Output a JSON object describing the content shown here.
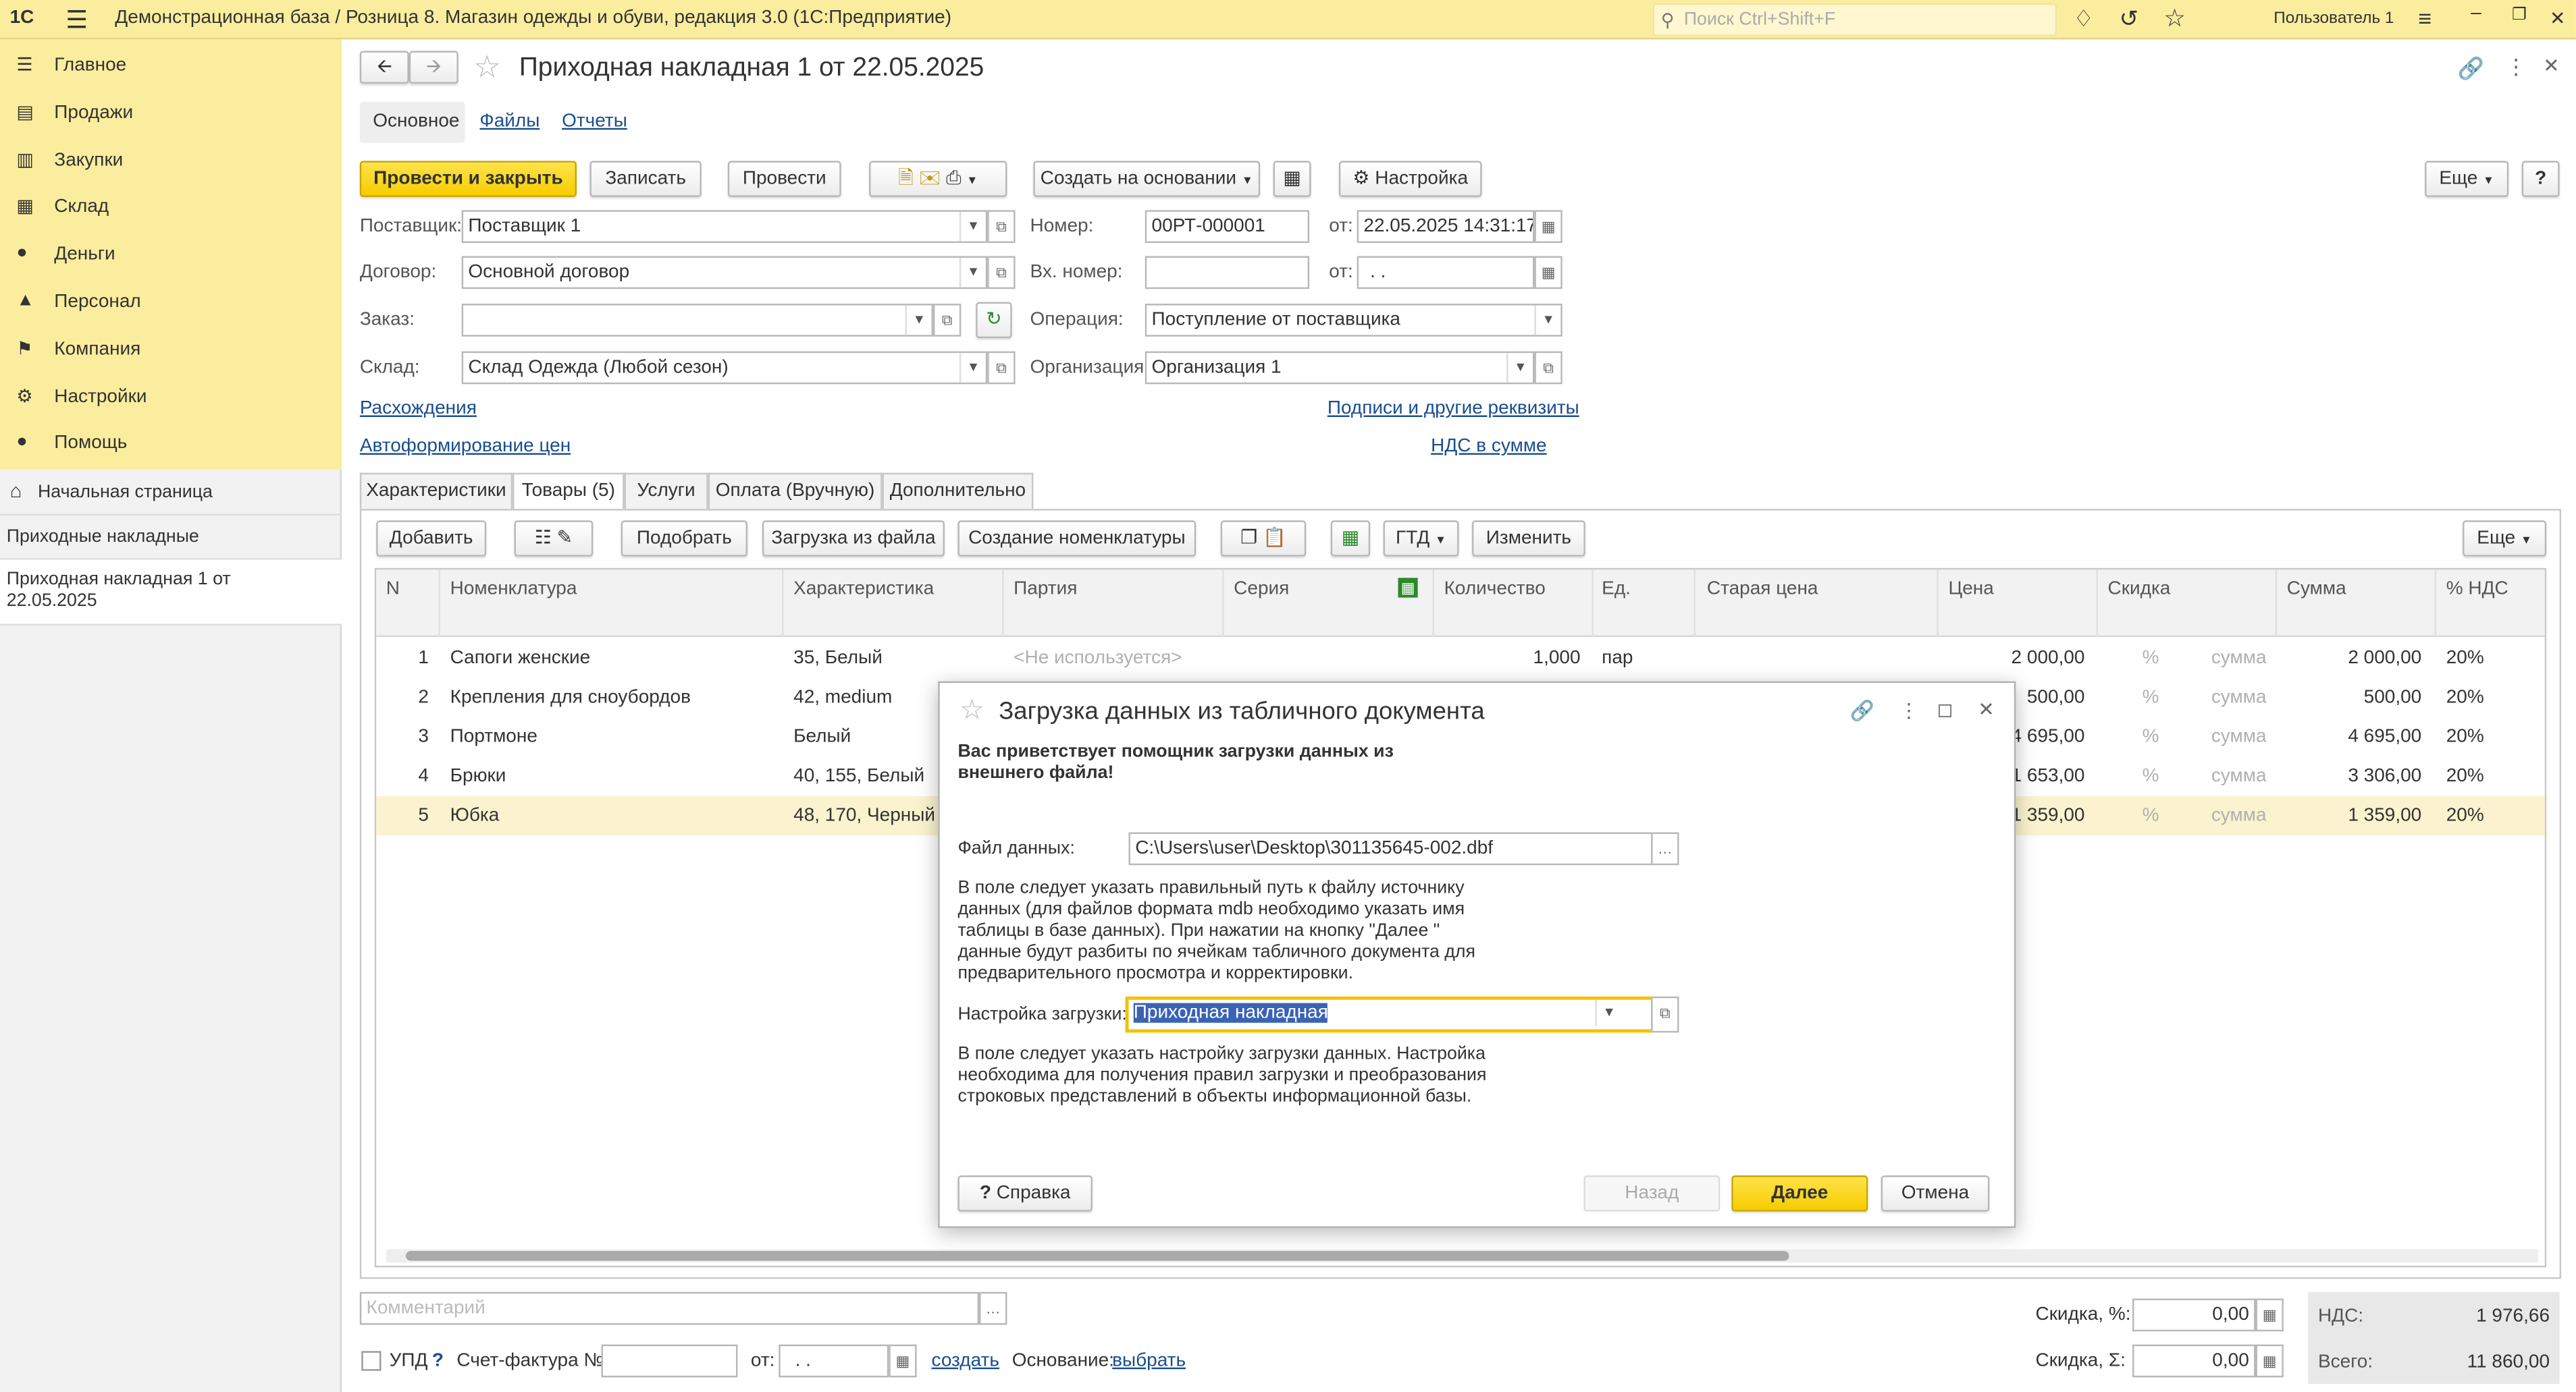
{
  "window": {
    "title": "Демонстрационная база / Розница 8. Магазин одежды и обуви, редакция 3.0  (1С:Предприятие)",
    "search_placeholder": "Поиск Ctrl+Shift+F",
    "user": "Пользователь 1",
    "logo": "1С"
  },
  "sidebar": {
    "items": [
      {
        "label": "Главное",
        "icon": "menu-icon"
      },
      {
        "label": "Продажи",
        "icon": "cart-icon"
      },
      {
        "label": "Закупки",
        "icon": "purchase-icon"
      },
      {
        "label": "Склад",
        "icon": "warehouse-icon"
      },
      {
        "label": "Деньги",
        "icon": "money-icon"
      },
      {
        "label": "Персонал",
        "icon": "people-icon"
      },
      {
        "label": "Компания",
        "icon": "flag-icon"
      },
      {
        "label": "Настройки",
        "icon": "gear-icon"
      },
      {
        "label": "Помощь",
        "icon": "help-icon"
      }
    ],
    "open": [
      {
        "label": "Начальная страница"
      },
      {
        "label": "Приходные накладные"
      },
      {
        "label": "Приходная накладная 1 от 22.05.2025"
      }
    ]
  },
  "doc": {
    "title": "Приходная накладная 1 от 22.05.2025",
    "subtabs": [
      "Основное",
      "Файлы",
      "Отчеты"
    ],
    "toolbar": {
      "post_close": "Провести и закрыть",
      "save": "Записать",
      "post": "Провести",
      "create_based": "Создать на основании",
      "settings": "Настройка",
      "more": "Еще",
      "help": "?"
    },
    "fields": {
      "supplier_label": "Поставщик:",
      "supplier": "Поставщик 1",
      "contract_label": "Договор:",
      "contract": "Основной договор",
      "order_label": "Заказ:",
      "order": "",
      "warehouse_label": "Склад:",
      "warehouse": "Склад Одежда (Любой сезон)",
      "number_label": "Номер:",
      "number": "00РТ-000001",
      "from_label": "от:",
      "date": "22.05.2025 14:31:17",
      "in_number_label": "Вх. номер:",
      "in_number": "",
      "from2_label": "от:",
      "in_date": " .  .",
      "operation_label": "Операция:",
      "operation": "Поступление от поставщика",
      "org_label": "Организация:",
      "org": "Организация 1"
    },
    "links": {
      "discrepancies": "Расхождения",
      "autoprice": "Автоформирование цен",
      "signatures": "Подписи и другие реквизиты",
      "vat_incl": "НДС в сумме"
    },
    "tabs": [
      "Характеристики",
      "Товары (5)",
      "Услуги",
      "Оплата (Вручную)",
      "Дополнительно"
    ],
    "table_toolbar": {
      "add": "Добавить",
      "pick": "Подобрать",
      "load_file": "Загрузка из файла",
      "create_nom": "Создание номенклатуры",
      "gtd": "ГТД",
      "change": "Изменить",
      "more": "Еще"
    },
    "columns": [
      "N",
      "Номенклатура",
      "Характеристика",
      "Партия",
      "Серия",
      "Количество",
      "Ед.",
      "Старая цена",
      "Цена",
      "Скидка",
      "Сумма",
      "% НДС"
    ],
    "rows": [
      {
        "n": "1",
        "name": "Сапоги женские",
        "char": "35, Белый",
        "batch": "<Не используется>",
        "qty": "1,000",
        "unit": "пар",
        "price": "2 000,00",
        "disc": "%",
        "disc_sum": "сумма",
        "sum": "2 000,00",
        "vat": "20%"
      },
      {
        "n": "2",
        "name": "Крепления для сноубордов",
        "char": "42, medium",
        "batch": "",
        "qty": "",
        "unit": "",
        "price": "500,00",
        "disc": "%",
        "disc_sum": "сумма",
        "sum": "500,00",
        "vat": "20%"
      },
      {
        "n": "3",
        "name": "Портмоне",
        "char": "Белый",
        "batch": "",
        "qty": "",
        "unit": "",
        "price": "4 695,00",
        "disc": "%",
        "disc_sum": "сумма",
        "sum": "4 695,00",
        "vat": "20%"
      },
      {
        "n": "4",
        "name": "Брюки",
        "char": "40, 155, Белый",
        "batch": "",
        "qty": "",
        "unit": "",
        "price": "1 653,00",
        "disc": "%",
        "disc_sum": "сумма",
        "sum": "3 306,00",
        "vat": "20%"
      },
      {
        "n": "5",
        "name": "Юбка",
        "char": "48, 170, Черный",
        "batch": "",
        "qty": "",
        "unit": "",
        "price": "1 359,00",
        "disc": "%",
        "disc_sum": "сумма",
        "sum": "1 359,00",
        "vat": "20%"
      }
    ],
    "footer": {
      "comment_placeholder": "Комментарий",
      "upd": "УПД",
      "upd_help": "?",
      "invoice_label": "Счет-фактура №:",
      "from": "от:",
      "invoice_date": " .  .",
      "create": "создать",
      "basis": "Основание:",
      "choose": "выбрать",
      "disc_pct_label": "Скидка, %:",
      "disc_pct": "0,00",
      "disc_sum_label": "Скидка, Σ:",
      "disc_sum": "0,00",
      "vat_label": "НДС:",
      "vat": "1 976,66",
      "total_label": "Всего:",
      "total": "11 860,00"
    }
  },
  "modal": {
    "title": "Загрузка данных из табличного документа",
    "welcome": "Вас приветствует помощник загрузки данных из внешнего файла!",
    "file_label": "Файл данных:",
    "file": "C:\\Users\\user\\Desktop\\301135645-002.dbf",
    "hint1": "В поле следует указать правильный путь к файлу источнику данных (для файлов формата mdb необходимо указать имя таблицы в базе данных). При нажатии на кнопку \"Далее \" данные будут разбиты по ячейкам табличного документа для предварительного просмотра и корректировки.",
    "setting_label": "Настройка загрузки:",
    "setting": "Приходная накладная",
    "hint2": "В поле следует указать настройку загрузки данных. Настройка необходима для получения правил загрузки и преобразования строковых представлений в объекты информационной базы.",
    "help": "Справка",
    "back": "Назад",
    "next": "Далее",
    "cancel": "Отмена"
  }
}
